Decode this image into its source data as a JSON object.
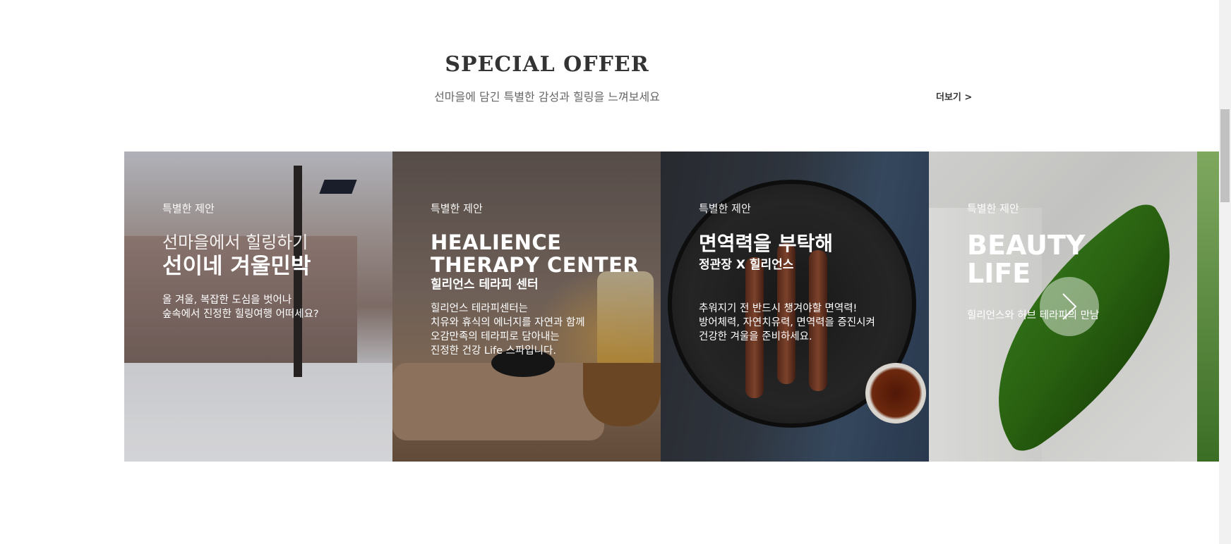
{
  "section": {
    "title": "SPECIAL OFFER",
    "subtitle": "선마을에 담긴 특별한 감성과 힐링을 느껴보세요",
    "more_label": "더보기 >"
  },
  "cards": [
    {
      "tag": "특별한 제안",
      "title_light": "선마을에서 힐링하기",
      "title_bold": "선이네 겨울민박",
      "desc_lines": [
        "올 겨울, 복잡한 도심을 벗어나",
        "숲속에서 진정한 힐링여행 어떠세요?"
      ]
    },
    {
      "tag": "특별한 제안",
      "title_line1": "HEALIENCE",
      "title_line2": "THERAPY CENTER",
      "subtitle": "힐리언스 테라피 센터",
      "desc_lines": [
        "힐리언스 테라피센터는",
        "치유와 휴식의 에너지를 자연과 함께",
        "오감만족의 테라피로 담아내는",
        "진정한 건강 Life 스파입니다."
      ]
    },
    {
      "tag": "특별한 제안",
      "title_bold": "면역력을 부탁해",
      "subtitle": "정관장 X 힐리언스",
      "desc_lines": [
        "추워지기 전 반드시 챙겨야할 면역력!",
        "방어체력, 자연치유력, 면역력을 증진시켜",
        "건강한 겨울을 준비하세요."
      ]
    },
    {
      "tag": "특별한 제안",
      "title_line1": "BEAUTY",
      "title_line2": "LIFE",
      "desc_lines": [
        "힐리언스와 허브 테라피의 만남"
      ]
    }
  ],
  "icons": {
    "next": "chevron-right-icon"
  }
}
